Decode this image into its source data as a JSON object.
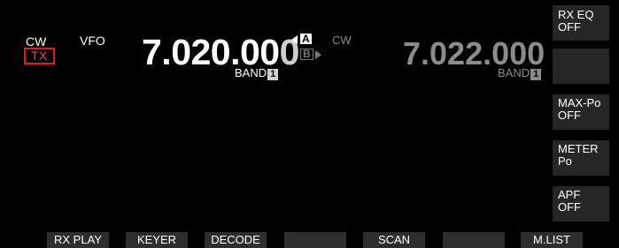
{
  "vfo_left": {
    "mode": "CW",
    "vfo_label": "VFO",
    "tx": "TX",
    "frequency_main": "7.020.00",
    "frequency_last_digit": "0",
    "band_label": "BAND",
    "band_number": "1"
  },
  "ab_indicator": {
    "a": "A",
    "b": "B"
  },
  "vfo_right": {
    "mode": "CW",
    "frequency": "7.022.000",
    "band_label": "BAND",
    "band_number": "1"
  },
  "side_keys": [
    {
      "line1": "RX EQ",
      "line2": "OFF"
    },
    {
      "line1": "",
      "line2": ""
    },
    {
      "line1": "MAX-Po",
      "line2": "OFF"
    },
    {
      "line1": "METER",
      "line2": "Po"
    },
    {
      "line1": "APF",
      "line2": "OFF"
    }
  ],
  "bottom_keys": [
    "RX PLAY",
    "KEYER",
    "DECODE",
    "",
    "SCAN",
    "",
    "M.LIST"
  ],
  "colors": {
    "background": "#000000",
    "tx_red": "#e21a1a",
    "key_gray": "#2e2e2e",
    "dim_text": "#8c8c8c"
  }
}
